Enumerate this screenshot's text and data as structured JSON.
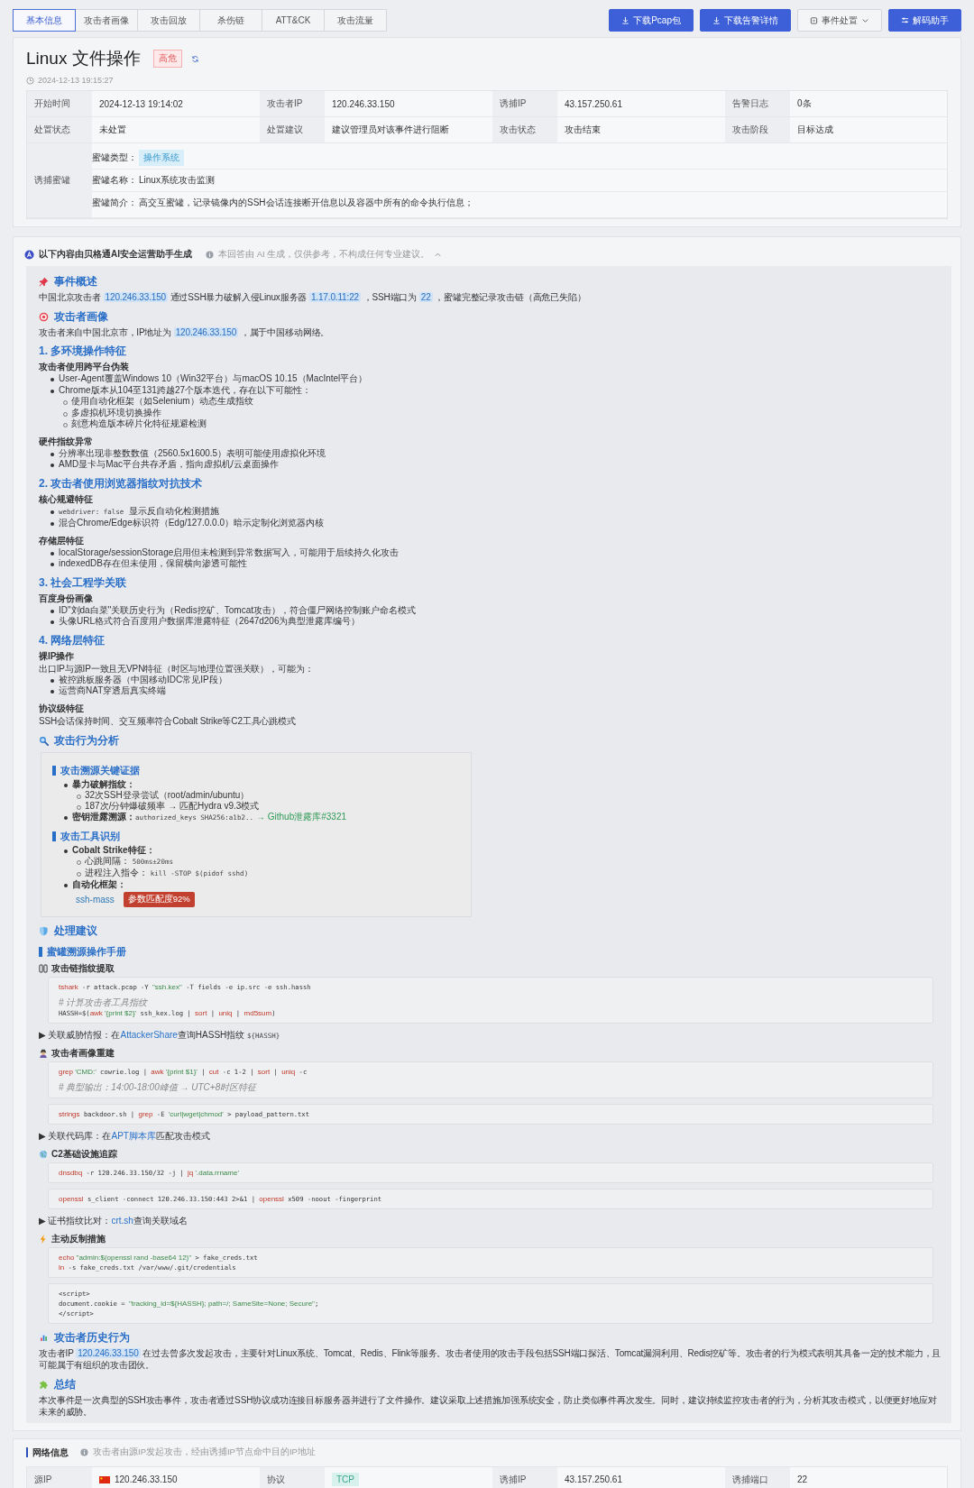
{
  "tabs": [
    {
      "label": "基本信息",
      "selected": true
    },
    {
      "label": "攻击者画像",
      "selected": false
    },
    {
      "label": "攻击回放",
      "selected": false
    },
    {
      "label": "杀伤链",
      "selected": false
    },
    {
      "label": "ATT&CK",
      "selected": false
    },
    {
      "label": "攻击流量",
      "selected": false
    }
  ],
  "actions": [
    {
      "label": "下载Pcap包",
      "kind": "download"
    },
    {
      "label": "下载告警详情",
      "kind": "download"
    },
    {
      "label": "事件处置",
      "kind": "menu"
    },
    {
      "label": "解码助手",
      "kind": "tool"
    }
  ],
  "event": {
    "title": "Linux 文件操作",
    "severity": "高危",
    "time": "2024-12-13 19:15:27",
    "fields": [
      {
        "label": "开始时间",
        "value": "2024-12-13 19:14:02"
      },
      {
        "label": "攻击者IP",
        "value": "120.246.33.150"
      },
      {
        "label": "诱捕IP",
        "value": "43.157.250.61"
      },
      {
        "label": "告警日志",
        "value": "0条"
      },
      {
        "label": "处置状态",
        "value": "未处置"
      },
      {
        "label": "处置建议",
        "value": "建议管理员对该事件进行阻断"
      },
      {
        "label": "攻击状态",
        "value": "攻击结束"
      },
      {
        "label": "攻击阶段",
        "value": "目标达成"
      }
    ],
    "honeypot": {
      "label": "诱捕蜜罐",
      "type_label": "蜜罐类型：",
      "type": "操作系统",
      "name_label": "蜜罐名称：",
      "name": "Linux系统攻击监测",
      "intro_label": "蜜罐简介：",
      "intro": "高交互蜜罐，记录镜像内的SSH会话连接断开信息以及容器中所有的命令执行信息；"
    }
  },
  "ai": {
    "title": "以下内容由贝格通AI安全运营助手生成",
    "note": "本回答由 AI 生成，仅供参考，不构成任何专业建议。",
    "expanded": true,
    "blocks": [
      {
        "kind": "section",
        "title": "事件概述"
      },
      {
        "kind": "para",
        "parts": [
          {
            "text": "中国北京攻击者 "
          },
          {
            "text": "120.246.33.150",
            "kind": "hl"
          },
          {
            "text": " 通过SSH暴力破解入侵Linux服务器 "
          },
          {
            "text": "1.17.0.11:22",
            "kind": "hl"
          },
          {
            "text": " ，SSH端口为 "
          },
          {
            "text": "22",
            "kind": "hl"
          },
          {
            "text": " ，蜜罐完整记录攻击链（高危已失陷）"
          }
        ]
      },
      {
        "kind": "section",
        "title": "攻击者画像"
      },
      {
        "kind": "para",
        "parts": [
          {
            "text": "攻击者来自中国北京市，IP地址为 "
          },
          {
            "text": "120.246.33.150",
            "kind": "hl"
          },
          {
            "text": " ，属于中国移动网络。"
          }
        ]
      },
      {
        "kind": "heading",
        "title": "1. 多环境操作特征"
      },
      {
        "kind": "sub",
        "text": "攻击者使用跨平台伪装"
      },
      {
        "kind": "list",
        "items": [
          {
            "parts": [
              {
                "text": "User-Agent覆盖Windows 10（Win32平台）与macOS 10.15（MacIntel平台）"
              }
            ]
          },
          {
            "parts": [
              {
                "text": "Chrome版本从104至131跨越27个版本迭代，存在以下可能性："
              }
            ],
            "children": [
              {
                "parts": [
                  {
                    "text": "使用自动化框架（如Selenium）动态生成指纹"
                  }
                ]
              },
              {
                "parts": [
                  {
                    "text": "多虚拟机环境切换操作"
                  }
                ]
              },
              {
                "parts": [
                  {
                    "text": "刻意构造版本碎片化特征规避检测"
                  }
                ]
              }
            ]
          }
        ]
      },
      {
        "kind": "sub",
        "text": "硬件指纹异常"
      },
      {
        "kind": "list",
        "items": [
          {
            "parts": [
              {
                "text": "分辨率出现非整数数值（2560.5x1600.5）表明可能使用虚拟化环境"
              }
            ]
          },
          {
            "parts": [
              {
                "text": "AMD显卡与Mac平台共存矛盾，指向虚拟机/云桌面操作"
              }
            ]
          }
        ]
      },
      {
        "kind": "heading",
        "title": "2. 攻击者使用浏览器指纹对抗技术"
      },
      {
        "kind": "sub",
        "text": "核心规避特征"
      },
      {
        "kind": "list",
        "items": [
          {
            "parts": [
              {
                "text": "webdriver: false",
                "kind": "code"
              },
              {
                "text": " 显示反自动化检测措施"
              }
            ]
          },
          {
            "parts": [
              {
                "text": "混合Chrome/Edge标识符（Edg/127.0.0.0）暗示定制化浏览器内核"
              }
            ]
          }
        ]
      },
      {
        "kind": "sub",
        "text": "存储层特征"
      },
      {
        "kind": "list",
        "items": [
          {
            "parts": [
              {
                "text": "localStorage/sessionStorage启用但未检测到异常数据写入，可能用于后续持久化攻击"
              }
            ]
          },
          {
            "parts": [
              {
                "text": "indexedDB存在但未使用，保留横向渗透可能性"
              }
            ]
          }
        ]
      },
      {
        "kind": "heading",
        "title": "3. 社会工程学关联"
      },
      {
        "kind": "sub",
        "text": "百度身份画像"
      },
      {
        "kind": "list",
        "items": [
          {
            "parts": [
              {
                "text": "ID\"刘da白菜\"关联历史行为（Redis挖矿、Tomcat攻击），符合僵尸网络控制账户命名模式"
              }
            ]
          },
          {
            "parts": [
              {
                "text": "头像URL格式符合百度用户数据库泄露特征（2647d206为典型泄露库编号）"
              }
            ]
          }
        ]
      },
      {
        "kind": "heading",
        "title": "4. 网络层特征"
      },
      {
        "kind": "sub",
        "text": "裸IP操作"
      },
      {
        "kind": "para",
        "parts": [
          {
            "text": "出口IP与源IP一致且无VPN特征（时区与地理位置强关联），可能为："
          }
        ]
      },
      {
        "kind": "list",
        "items": [
          {
            "parts": [
              {
                "text": "被控跳板服务器（中国移动IDC常见IP段）"
              }
            ]
          },
          {
            "parts": [
              {
                "text": "运营商NAT穿透后真实终端"
              }
            ]
          }
        ]
      },
      {
        "kind": "sub",
        "text": "协议级特征"
      },
      {
        "kind": "para",
        "parts": [
          {
            "text": "SSH会话保持时间、交互频率符合Cobalt Strike等C2工具心跳模式"
          }
        ]
      },
      {
        "kind": "section",
        "title": "攻击行为分析"
      },
      {
        "kind": "panel",
        "blocks": [
          {
            "kind": "bar",
            "title": "攻击溯源关键证据"
          },
          {
            "kind": "list",
            "items": [
              {
                "parts": [
                  {
                    "text": "暴力破解指纹：",
                    "kind": "bold"
                  }
                ],
                "children": [
                  {
                    "parts": [
                      {
                        "text": "32次SSH登录尝试（root/admin/ubuntu）"
                      }
                    ]
                  },
                  {
                    "parts": [
                      {
                        "text": "187次/分钟爆破频率 → 匹配Hydra v9.3模式"
                      }
                    ]
                  }
                ]
              },
              {
                "parts": [
                  {
                    "text": "密钥泄露溯源：",
                    "kind": "bold"
                  },
                  {
                    "text": "authorized_keys SHA256:a1b2..",
                    "kind": "code"
                  },
                  {
                    "text": "→ Github泄露库#3321",
                    "kind": "green"
                  }
                ]
              }
            ]
          },
          {
            "kind": "bar",
            "title": "攻击工具识别"
          },
          {
            "kind": "list",
            "items": [
              {
                "parts": [
                  {
                    "text": "Cobalt Strike特征：",
                    "kind": "bold"
                  }
                ],
                "children": [
                  {
                    "parts": [
                      {
                        "text": "心跳间隔： "
                      },
                      {
                        "text": "500ms±20ms",
                        "kind": "code"
                      }
                    ]
                  },
                  {
                    "parts": [
                      {
                        "text": "进程注入指令： "
                      },
                      {
                        "text": "kill -STOP $(pidof sshd)",
                        "kind": "code"
                      }
                    ]
                  }
                ]
              },
              {
                "parts": [
                  {
                    "text": "自动化框架：",
                    "kind": "bold"
                  }
                ]
              }
            ]
          },
          {
            "kind": "tool",
            "name": "ssh-mass",
            "badge": "参数匹配度92%"
          }
        ]
      },
      {
        "kind": "section",
        "title": "处理建议"
      },
      {
        "kind": "bar",
        "title": "蜜罐溯源操作手册"
      },
      {
        "kind": "step",
        "text": "攻击链指纹提取"
      },
      {
        "kind": "code",
        "lines": [
          {
            "tokens": [
              {
                "text": "tshark",
                "kind": "cmd"
              },
              {
                "text": " -r attack.pcap -Y "
              },
              {
                "text": "\"ssh.kex\"",
                "kind": "str"
              },
              {
                "text": " -T fields -e ip.src -e ssh.hassh"
              }
            ]
          },
          {
            "gap": true,
            "tokens": [
              {
                "text": "# 计算攻击者工具指纹",
                "kind": "comment"
              }
            ]
          },
          {
            "tokens": [
              {
                "text": "HASSH=$("
              },
              {
                "text": "awk",
                "kind": "cmd"
              },
              {
                "text": " '{print $2}'",
                "kind": "str"
              },
              {
                "text": " ssh_kex.log | "
              },
              {
                "text": "sort",
                "kind": "cmd"
              },
              {
                "text": " | "
              },
              {
                "text": "uniq",
                "kind": "cmd"
              },
              {
                "text": " | "
              },
              {
                "text": "md5sum",
                "kind": "cmd"
              },
              {
                "text": ")"
              }
            ]
          }
        ]
      },
      {
        "kind": "detail",
        "parts": [
          {
            "text": "▶ 关联威胁情报：在"
          },
          {
            "text": "AttackerShare",
            "kind": "link"
          },
          {
            "text": "查询HASSH指纹 "
          },
          {
            "text": "${HASSH}",
            "kind": "code"
          }
        ]
      },
      {
        "kind": "step",
        "text": "攻击者画像重建"
      },
      {
        "kind": "code",
        "lines": [
          {
            "tokens": [
              {
                "text": "grep",
                "kind": "cmd"
              },
              {
                "text": " 'CMD:'",
                "kind": "str"
              },
              {
                "text": " cowrie.log | "
              },
              {
                "text": "awk",
                "kind": "cmd"
              },
              {
                "text": " '{print $1}'",
                "kind": "str"
              },
              {
                "text": " | "
              },
              {
                "text": "cut",
                "kind": "cmd"
              },
              {
                "text": " -c 1-2 | "
              },
              {
                "text": "sort",
                "kind": "cmd"
              },
              {
                "text": " | "
              },
              {
                "text": "uniq",
                "kind": "cmd"
              },
              {
                "text": " -c"
              }
            ]
          },
          {
            "gap": true,
            "tokens": [
              {
                "text": "# 典型输出：14:00-18:00峰值 → UTC+8时区特征",
                "kind": "comment"
              }
            ]
          }
        ]
      },
      {
        "kind": "code",
        "lines": [
          {
            "tokens": [
              {
                "text": "strings",
                "kind": "cmd"
              },
              {
                "text": " backdoor.sh | "
              },
              {
                "text": "grep",
                "kind": "cmd"
              },
              {
                "text": " -E "
              },
              {
                "text": "'curl|wget|chmod'",
                "kind": "str"
              },
              {
                "text": " > payload_pattern.txt"
              }
            ]
          }
        ]
      },
      {
        "kind": "detail",
        "parts": [
          {
            "text": "▶ 关联代码库：在"
          },
          {
            "text": "APT脚本库",
            "kind": "link"
          },
          {
            "text": "匹配攻击模式"
          }
        ]
      },
      {
        "kind": "step",
        "text": "C2基础设施追踪"
      },
      {
        "kind": "code",
        "lines": [
          {
            "tokens": [
              {
                "text": "dnsdbq",
                "kind": "cmd"
              },
              {
                "text": " -r 120.246.33.150/32 -j | "
              },
              {
                "text": "jq",
                "kind": "cmd"
              },
              {
                "text": " '.data.rrname'",
                "kind": "str"
              }
            ]
          }
        ]
      },
      {
        "kind": "code",
        "lines": [
          {
            "tokens": [
              {
                "text": "openssl",
                "kind": "cmd"
              },
              {
                "text": " s_client -connect 120.246.33.150:443 2>&1 | "
              },
              {
                "text": "openssl",
                "kind": "cmd"
              },
              {
                "text": " x509 -noout -fingerprint"
              }
            ]
          }
        ]
      },
      {
        "kind": "detail",
        "parts": [
          {
            "text": "▶ 证书指纹比对："
          },
          {
            "text": "crt.sh",
            "kind": "link"
          },
          {
            "text": "查询关联域名"
          }
        ]
      },
      {
        "kind": "step",
        "text": "主动反制措施"
      },
      {
        "kind": "code",
        "lines": [
          {
            "tokens": [
              {
                "text": "echo",
                "kind": "cmd"
              },
              {
                "text": " \"admin:$(openssl rand -base64 12)\"",
                "kind": "str"
              },
              {
                "text": " > fake_creds.txt"
              }
            ]
          },
          {
            "tokens": [
              {
                "text": "ln",
                "kind": "cmd"
              },
              {
                "text": " -s fake_creds.txt /var/www/.git/credentials"
              }
            ]
          }
        ]
      },
      {
        "kind": "code",
        "lines": [
          {
            "tokens": [
              {
                "text": "<script>"
              }
            ]
          },
          {
            "tokens": [
              {
                "text": "document.cookie = "
              },
              {
                "text": "\"tracking_id=${HASSH}; path=/; SameSite=None; Secure\"",
                "kind": "str"
              },
              {
                "text": ";"
              }
            ]
          },
          {
            "tokens": [
              {
                "text": "</script>"
              }
            ]
          }
        ]
      },
      {
        "kind": "section",
        "title": "攻击者历史行为"
      },
      {
        "kind": "para",
        "parts": [
          {
            "text": "攻击者IP "
          },
          {
            "text": "120.246.33.150",
            "kind": "hl"
          },
          {
            "text": " 在过去曾多次发起攻击，主要针对Linux系统、Tomcat、Redis、Flink等服务。攻击者使用的攻击手段包括SSH端口探活、Tomcat漏洞利用、Redis挖矿等。攻击者的行为模式表明其具备一定的技术能力，且可能属于有组织的攻击团伙。"
          }
        ]
      },
      {
        "kind": "section",
        "title": "总结"
      },
      {
        "kind": "para",
        "parts": [
          {
            "text": "本次事件是一次典型的SSH攻击事件，攻击者通过SSH协议成功连接目标服务器并进行了文件操作。建议采取上述措施加强系统安全，防止类似事件再次发生。同时，建议持续监控攻击者的行为，分析其攻击模式，以便更好地应对未来的威胁。"
          }
        ]
      }
    ]
  },
  "network": {
    "title": "网络信息",
    "note": "攻击者由源IP发起攻击，经由诱捕IP节点命中目的IP地址",
    "fields": [
      {
        "label": "源IP",
        "value": "120.246.33.150",
        "kind": "flag"
      },
      {
        "label": "协议",
        "value": "TCP",
        "kind": "tag"
      },
      {
        "label": "诱捕IP",
        "value": "43.157.250.61",
        "kind": "text"
      },
      {
        "label": "诱捕端口",
        "value": "22",
        "kind": "text"
      }
    ]
  }
}
